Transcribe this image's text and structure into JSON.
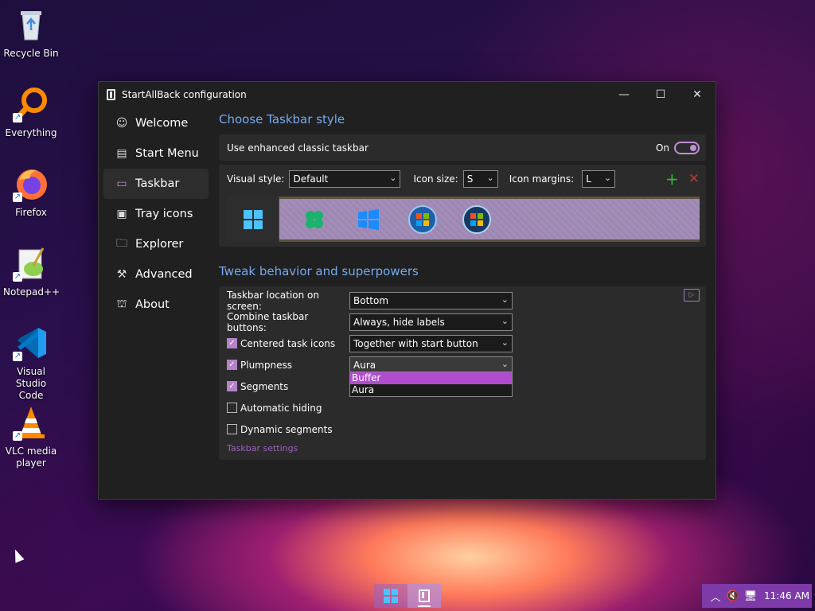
{
  "desktop": {
    "icons": [
      {
        "label": "Recycle Bin",
        "icon": "recycle-bin-icon"
      },
      {
        "label": "Everything",
        "icon": "everything-search-icon"
      },
      {
        "label": "Firefox",
        "icon": "firefox-icon"
      },
      {
        "label": "Notepad++",
        "icon": "notepadpp-icon"
      },
      {
        "label": "Visual Studio Code",
        "icon": "vscode-icon"
      },
      {
        "label": "VLC media player",
        "icon": "vlc-icon"
      }
    ]
  },
  "window": {
    "title": "StartAllBack configuration",
    "controls": {
      "minimize": "—",
      "maximize": "☐",
      "close": "✕"
    }
  },
  "sidebar": {
    "items": [
      {
        "label": "Welcome",
        "icon": "smile-icon"
      },
      {
        "label": "Start Menu",
        "icon": "start-menu-icon"
      },
      {
        "label": "Taskbar",
        "icon": "taskbar-icon",
        "active": true
      },
      {
        "label": "Tray icons",
        "icon": "tray-icon"
      },
      {
        "label": "Explorer",
        "icon": "folder-icon"
      },
      {
        "label": "Advanced",
        "icon": "wrench-icon"
      },
      {
        "label": "About",
        "icon": "about-icon"
      }
    ]
  },
  "taskbar_style": {
    "title": "Choose Taskbar style",
    "enhanced_label": "Use enhanced classic taskbar",
    "toggle_label": "On",
    "visual_style_label": "Visual style:",
    "visual_style_value": "Default",
    "icon_size_label": "Icon size:",
    "icon_size_value": "S",
    "icon_margins_label": "Icon margins:",
    "icon_margins_value": "L"
  },
  "tweak": {
    "title": "Tweak behavior and superpowers",
    "location_label": "Taskbar location on screen:",
    "location_value": "Bottom",
    "combine_label": "Combine taskbar buttons:",
    "combine_value": "Always, hide labels",
    "centered_label": "Centered task icons",
    "centered_value": "Together with start button",
    "plumpness_label": "Plumpness",
    "plumpness_value": "Aura",
    "plumpness_options": [
      "Buffer",
      "Aura"
    ],
    "segments_label": "Segments",
    "autohide_label": "Automatic hiding",
    "dynamic_label": "Dynamic segments",
    "settings_link": "Taskbar settings",
    "checked": {
      "centered": true,
      "plumpness": true,
      "segments": true,
      "autohide": false,
      "dynamic": false
    }
  },
  "tray": {
    "clock": "11:46 AM"
  }
}
